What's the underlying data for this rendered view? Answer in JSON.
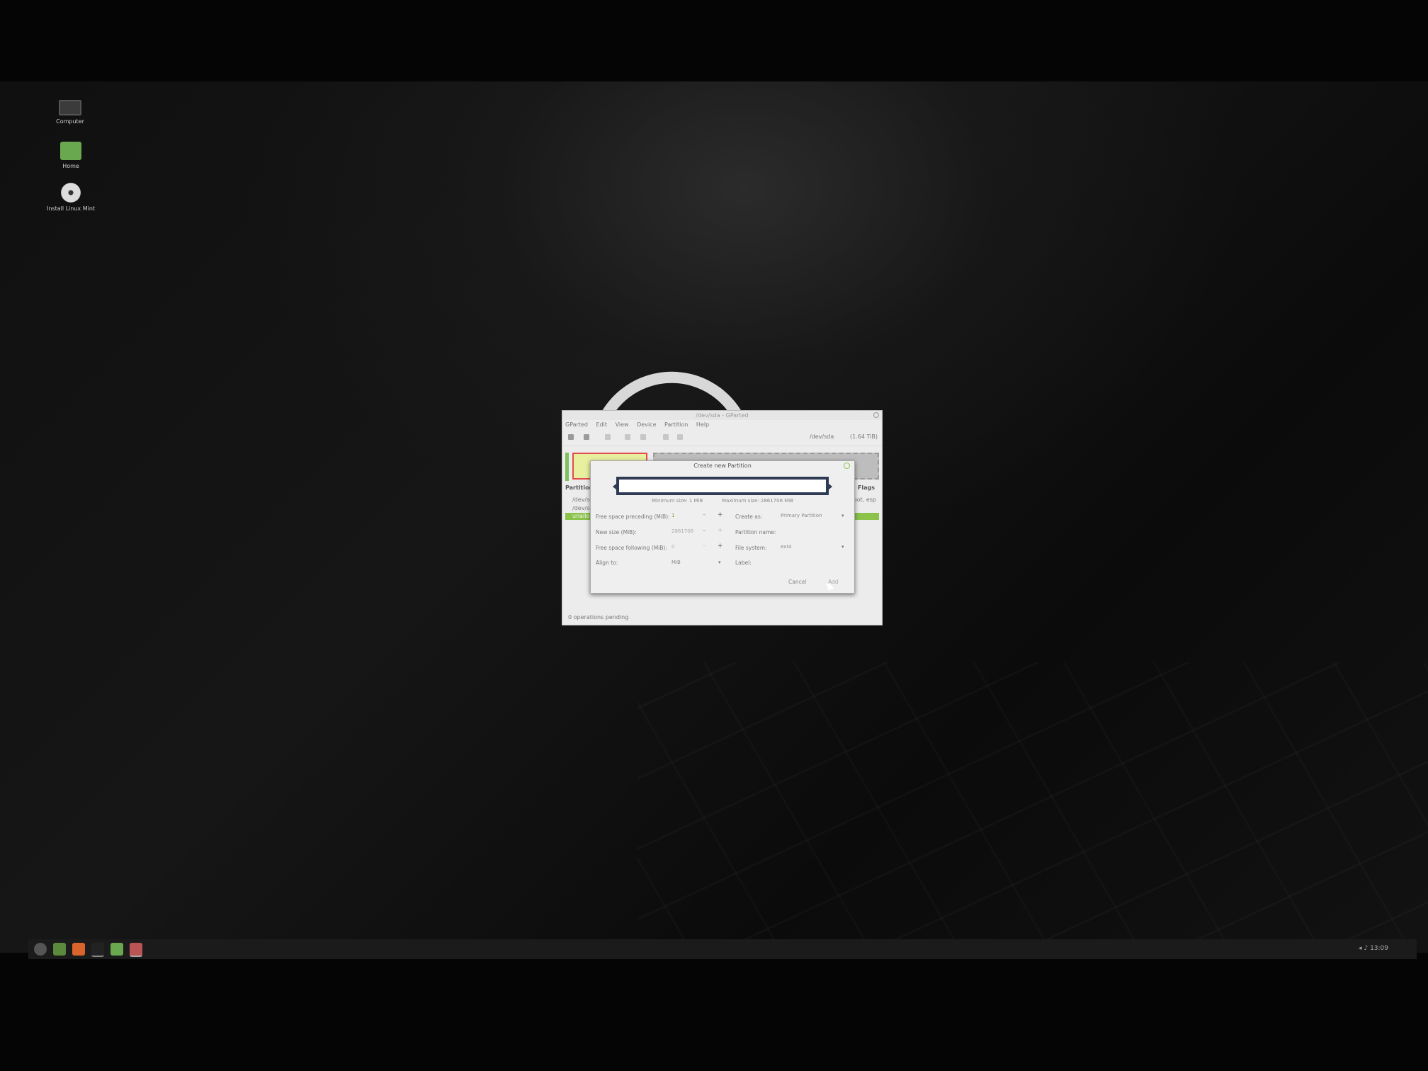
{
  "desktop": {
    "icons": [
      {
        "label": "Computer",
        "icon": "monitor-icon"
      },
      {
        "label": "Home",
        "icon": "folder-icon"
      },
      {
        "label": "Install Linux Mint",
        "icon": "disc-icon"
      }
    ]
  },
  "taskbar": {
    "clock": "13:09"
  },
  "gparted": {
    "title": "/dev/sda - GParted",
    "menu": [
      "GParted",
      "Edit",
      "View",
      "Device",
      "Partition",
      "Help"
    ],
    "device": "/dev/sda",
    "device_size": "(1.64 TiB)",
    "list_header_partition": "Partition",
    "list_header_flags": "Flags",
    "rows": [
      "/dev/sd",
      "/dev/sd",
      "unallo"
    ],
    "flag_value": "boot, esp",
    "status": "0 operations pending"
  },
  "dialog": {
    "title": "Create new Partition",
    "minimum_size": "Minimum size: 1 MiB",
    "maximum_size": "Maximum size: 2861706 MiB",
    "free_space_preceding_label": "Free space preceding (MiB):",
    "free_space_preceding_value": "1",
    "new_size_label": "New size (MiB):",
    "new_size_value": "2861706",
    "free_space_following_label": "Free space following (MiB):",
    "free_space_following_value": "0",
    "align_to_label": "Align to:",
    "align_to_value": "MiB",
    "create_as_label": "Create as:",
    "create_as_value": "Primary Partition",
    "partition_name_label": "Partition name:",
    "file_system_label": "File system:",
    "file_system_value": "ext4",
    "label_label": "Label:",
    "cancel": "Cancel",
    "add": "Add"
  }
}
